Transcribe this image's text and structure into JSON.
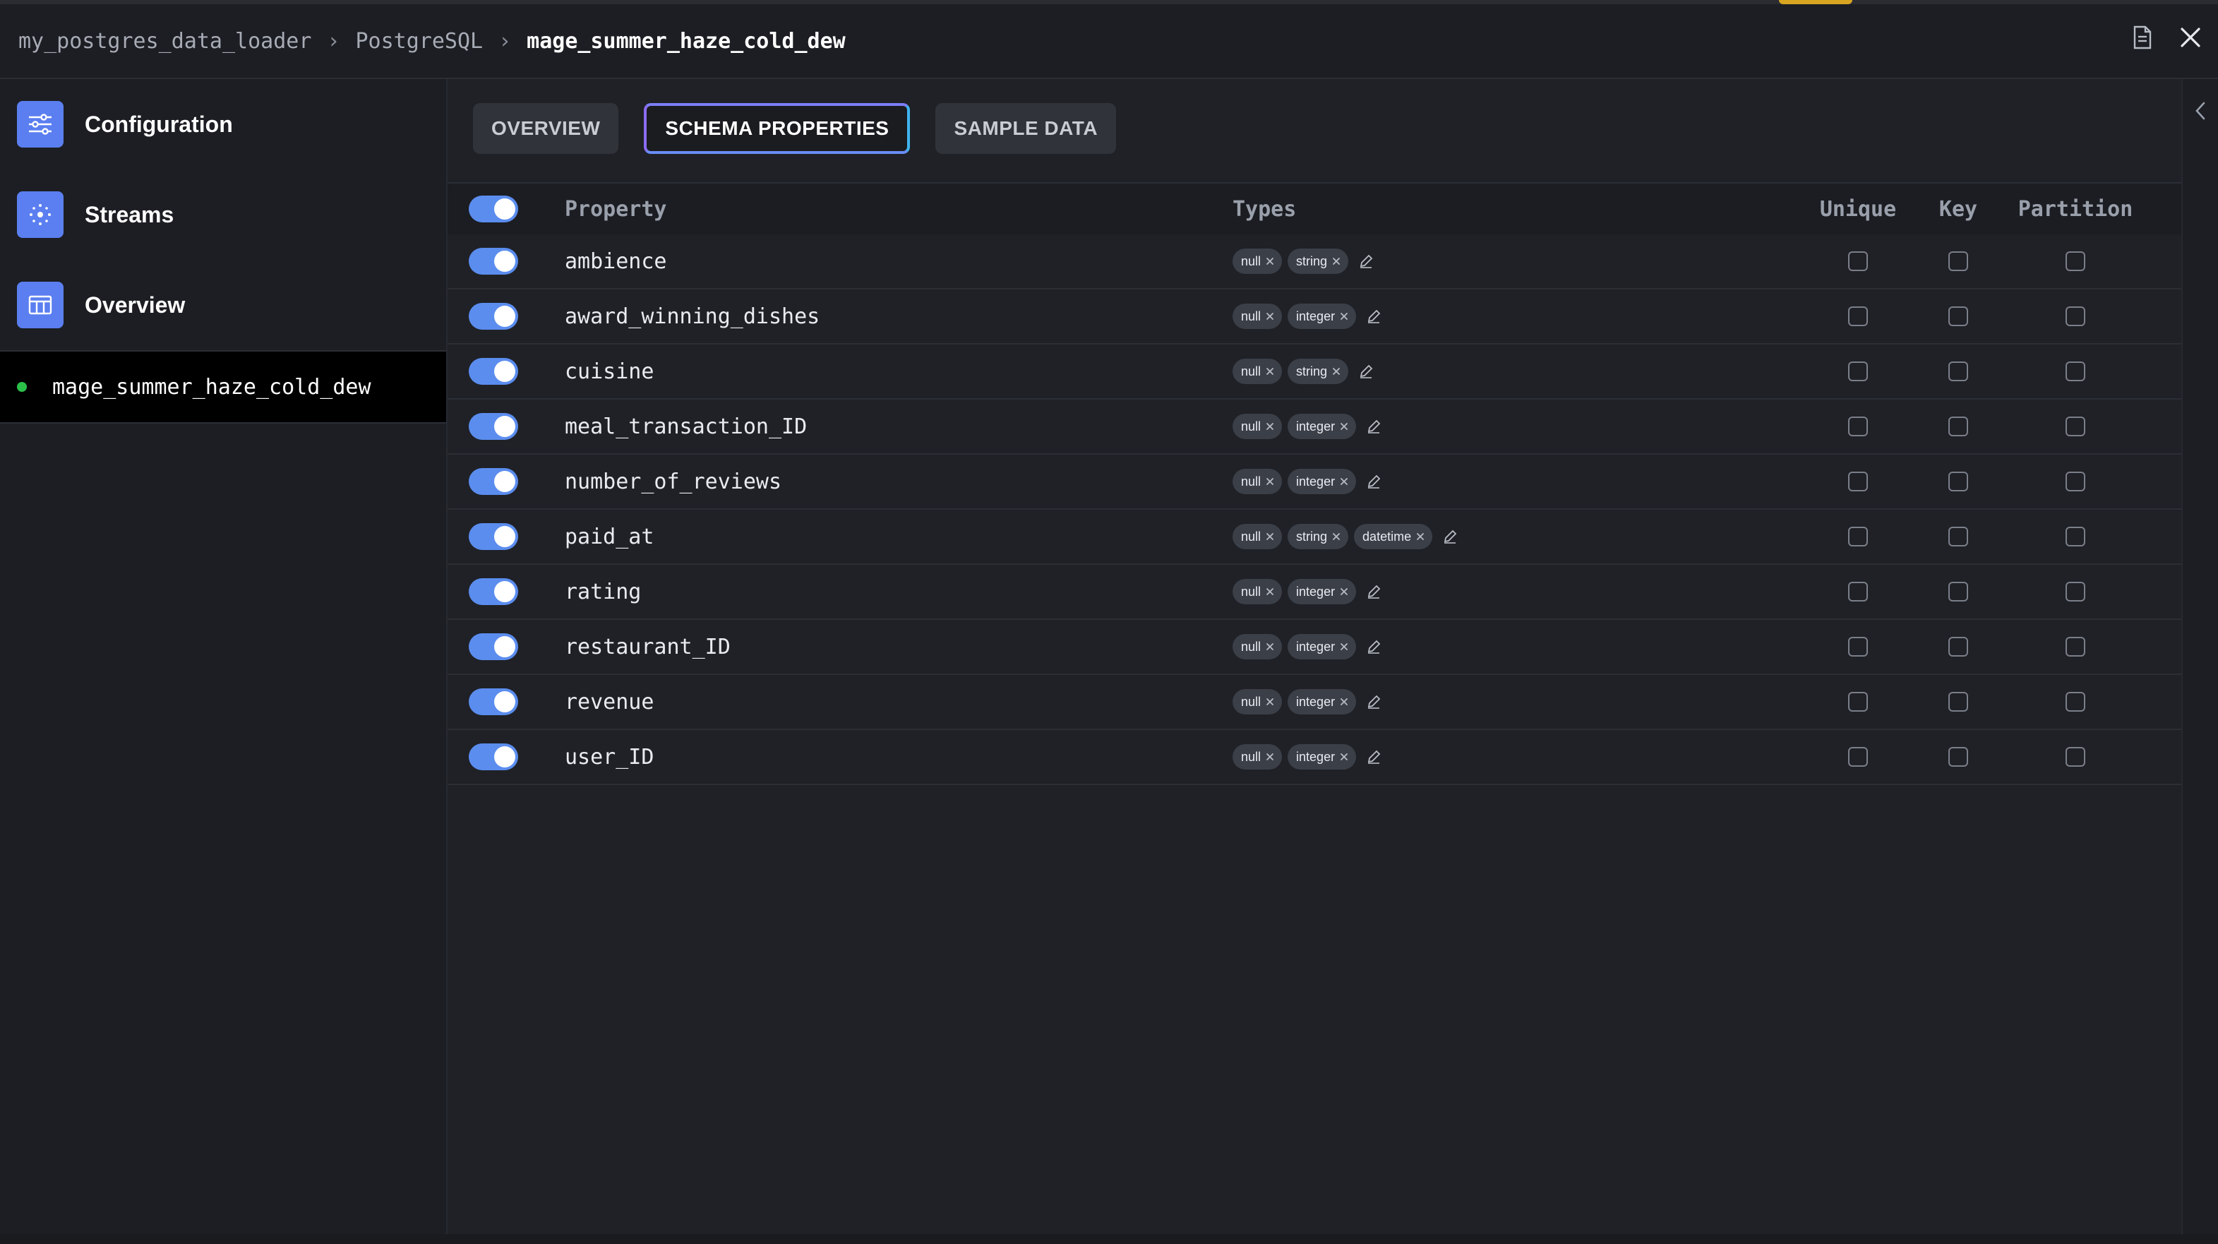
{
  "breadcrumb": {
    "items": [
      "my_postgres_data_loader",
      "PostgreSQL",
      "mage_summer_haze_cold_dew"
    ]
  },
  "header": {
    "icons": [
      "document-icon",
      "close-icon"
    ]
  },
  "sidebar": {
    "items": [
      {
        "label": "Configuration",
        "icon": "sliders-icon"
      },
      {
        "label": "Streams",
        "icon": "streams-icon"
      },
      {
        "label": "Overview",
        "icon": "table-icon"
      }
    ],
    "stream": {
      "label": "mage_summer_haze_cold_dew",
      "status_color": "#2bbf4a"
    }
  },
  "tabs": [
    {
      "label": "OVERVIEW",
      "active": false
    },
    {
      "label": "SCHEMA PROPERTIES",
      "active": true
    },
    {
      "label": "SAMPLE DATA",
      "active": false
    }
  ],
  "table": {
    "headers": {
      "property": "Property",
      "types": "Types",
      "unique": "Unique",
      "key": "Key",
      "partition": "Partition"
    },
    "rows": [
      {
        "property": "ambience",
        "types": [
          "null",
          "string"
        ],
        "enabled": true,
        "unique": false,
        "key": false,
        "partition": false
      },
      {
        "property": "award_winning_dishes",
        "types": [
          "null",
          "integer"
        ],
        "enabled": true,
        "unique": false,
        "key": false,
        "partition": false
      },
      {
        "property": "cuisine",
        "types": [
          "null",
          "string"
        ],
        "enabled": true,
        "unique": false,
        "key": false,
        "partition": false
      },
      {
        "property": "meal_transaction_ID",
        "types": [
          "null",
          "integer"
        ],
        "enabled": true,
        "unique": false,
        "key": false,
        "partition": false
      },
      {
        "property": "number_of_reviews",
        "types": [
          "null",
          "integer"
        ],
        "enabled": true,
        "unique": false,
        "key": false,
        "partition": false
      },
      {
        "property": "paid_at",
        "types": [
          "null",
          "string",
          "datetime"
        ],
        "enabled": true,
        "unique": false,
        "key": false,
        "partition": false
      },
      {
        "property": "rating",
        "types": [
          "null",
          "integer"
        ],
        "enabled": true,
        "unique": false,
        "key": false,
        "partition": false
      },
      {
        "property": "restaurant_ID",
        "types": [
          "null",
          "integer"
        ],
        "enabled": true,
        "unique": false,
        "key": false,
        "partition": false
      },
      {
        "property": "revenue",
        "types": [
          "null",
          "integer"
        ],
        "enabled": true,
        "unique": false,
        "key": false,
        "partition": false
      },
      {
        "property": "user_ID",
        "types": [
          "null",
          "integer"
        ],
        "enabled": true,
        "unique": false,
        "key": false,
        "partition": false
      }
    ]
  },
  "colors": {
    "accent": "#5b7ff0",
    "toggle_on": "#5b8def",
    "tab_active_border": "#8c6cf5"
  }
}
